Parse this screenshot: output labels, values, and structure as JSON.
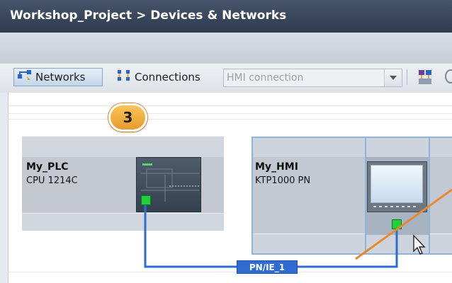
{
  "window": {
    "title": "Workshop_Project > Devices & Networks"
  },
  "toolbar": {
    "networks_label": "Networks",
    "connections_label": "Connections",
    "connection_type": {
      "value": "HMI connection"
    }
  },
  "step_badge": {
    "number": "3"
  },
  "devices": [
    {
      "name": "My_PLC",
      "type": "CPU 1214C"
    },
    {
      "name": "My_HMI",
      "type": "KTP1000 PN"
    }
  ],
  "network": {
    "label": "PN/IE_1",
    "line_color": "#2f6bd3"
  },
  "colors": {
    "port_active": "#1fd03a",
    "annotation_line": "#e8892c",
    "title_bar": "#3a475a"
  },
  "icons": [
    "networks-icon",
    "connections-icon",
    "dropdown-arrow-icon",
    "highlight-icon",
    "cursor-icon"
  ]
}
